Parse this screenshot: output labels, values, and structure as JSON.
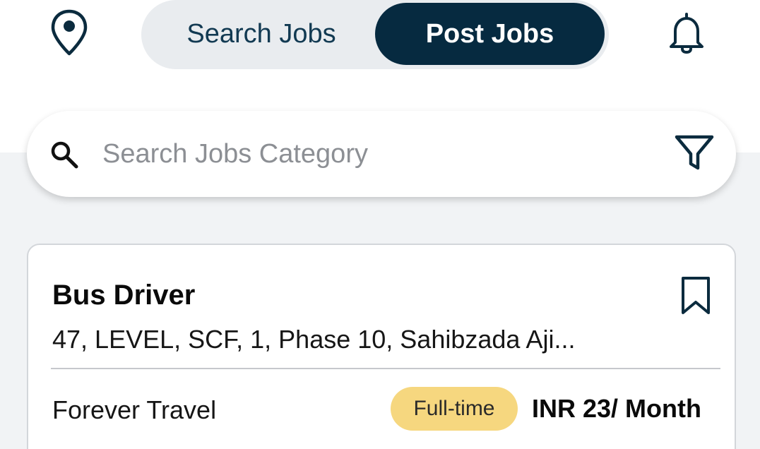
{
  "header": {
    "location_icon": "location-pin-icon",
    "tabs": [
      {
        "label": "Search Jobs",
        "active": false
      },
      {
        "label": "Post Jobs",
        "active": true
      }
    ],
    "notification_icon": "bell-icon"
  },
  "search": {
    "icon": "search-icon",
    "placeholder": "Search Jobs Category",
    "value": "",
    "filter_icon": "filter-icon"
  },
  "job_card": {
    "title": "Bus Driver",
    "address": "47, LEVEL, SCF, 1, Phase 10, Sahibzada Aji...",
    "bookmark_icon": "bookmark-icon",
    "company": "Forever Travel",
    "employment_type": "Full-time",
    "salary": "INR 23/ Month"
  },
  "colors": {
    "primary_dark": "#062a40",
    "badge_yellow": "#f6d77f",
    "background": "#f1f3f5",
    "toggle_bg": "#e9ecef"
  }
}
